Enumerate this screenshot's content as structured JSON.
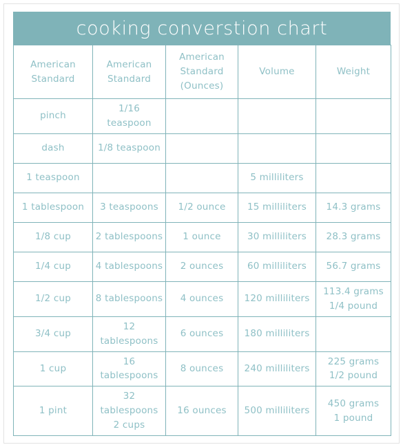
{
  "page": {
    "title_bar_color": "#7fb3b8",
    "grid_color": "#7fb3b8",
    "text_color": "#8fc0c6",
    "title_text_color": "#ffffff",
    "background_color": "#ffffff"
  },
  "chart": {
    "title": "cooking converstion chart",
    "columns": [
      "American Standard",
      "American Standard",
      "American Standard (Ounces)",
      "Volume",
      "Weight"
    ],
    "column_lines": [
      [
        "American",
        "Standard"
      ],
      [
        "American",
        "Standard"
      ],
      [
        "American",
        "Standard",
        "(Ounces)"
      ],
      [
        "Volume"
      ],
      [
        "Weight"
      ]
    ],
    "rows": [
      {
        "american_standard_1": [
          "pinch"
        ],
        "american_standard_2": [
          "1/16 teaspoon"
        ],
        "ounces": [],
        "volume": [],
        "weight": []
      },
      {
        "american_standard_1": [
          "dash"
        ],
        "american_standard_2": [
          "1/8 teaspoon"
        ],
        "ounces": [],
        "volume": [],
        "weight": []
      },
      {
        "american_standard_1": [
          "1 teaspoon"
        ],
        "american_standard_2": [],
        "ounces": [],
        "volume": [
          "5 milliliters"
        ],
        "weight": []
      },
      {
        "american_standard_1": [
          "1 tablespoon"
        ],
        "american_standard_2": [
          "3 teaspoons"
        ],
        "ounces": [
          "1/2 ounce"
        ],
        "volume": [
          "15 milliliters"
        ],
        "weight": [
          "14.3 grams"
        ]
      },
      {
        "american_standard_1": [
          "1/8 cup"
        ],
        "american_standard_2": [
          "2 tablespoons"
        ],
        "ounces": [
          "1 ounce"
        ],
        "volume": [
          "30 milliliters"
        ],
        "weight": [
          "28.3 grams"
        ]
      },
      {
        "american_standard_1": [
          "1/4 cup"
        ],
        "american_standard_2": [
          "4 tablespoons"
        ],
        "ounces": [
          "2 ounces"
        ],
        "volume": [
          "60 milliliters"
        ],
        "weight": [
          "56.7 grams"
        ]
      },
      {
        "american_standard_1": [
          "1/2 cup"
        ],
        "american_standard_2": [
          "8 tablespoons"
        ],
        "ounces": [
          "4 ounces"
        ],
        "volume": [
          "120 milliliters"
        ],
        "weight": [
          "113.4 grams",
          "1/4 pound"
        ]
      },
      {
        "american_standard_1": [
          "3/4 cup"
        ],
        "american_standard_2": [
          "12 tablespoons"
        ],
        "ounces": [
          "6 ounces"
        ],
        "volume": [
          "180 milliliters"
        ],
        "weight": []
      },
      {
        "american_standard_1": [
          "1 cup"
        ],
        "american_standard_2": [
          "16 tablespoons"
        ],
        "ounces": [
          "8 ounces"
        ],
        "volume": [
          "240 milliliters"
        ],
        "weight": [
          "225 grams",
          "1/2 pound"
        ]
      },
      {
        "american_standard_1": [
          "1 pint"
        ],
        "american_standard_2": [
          "32 tablespoons",
          "2 cups"
        ],
        "ounces": [
          "16 ounces"
        ],
        "volume": [
          "500 milliliters"
        ],
        "weight": [
          "450 grams",
          "1 pound"
        ]
      }
    ]
  }
}
